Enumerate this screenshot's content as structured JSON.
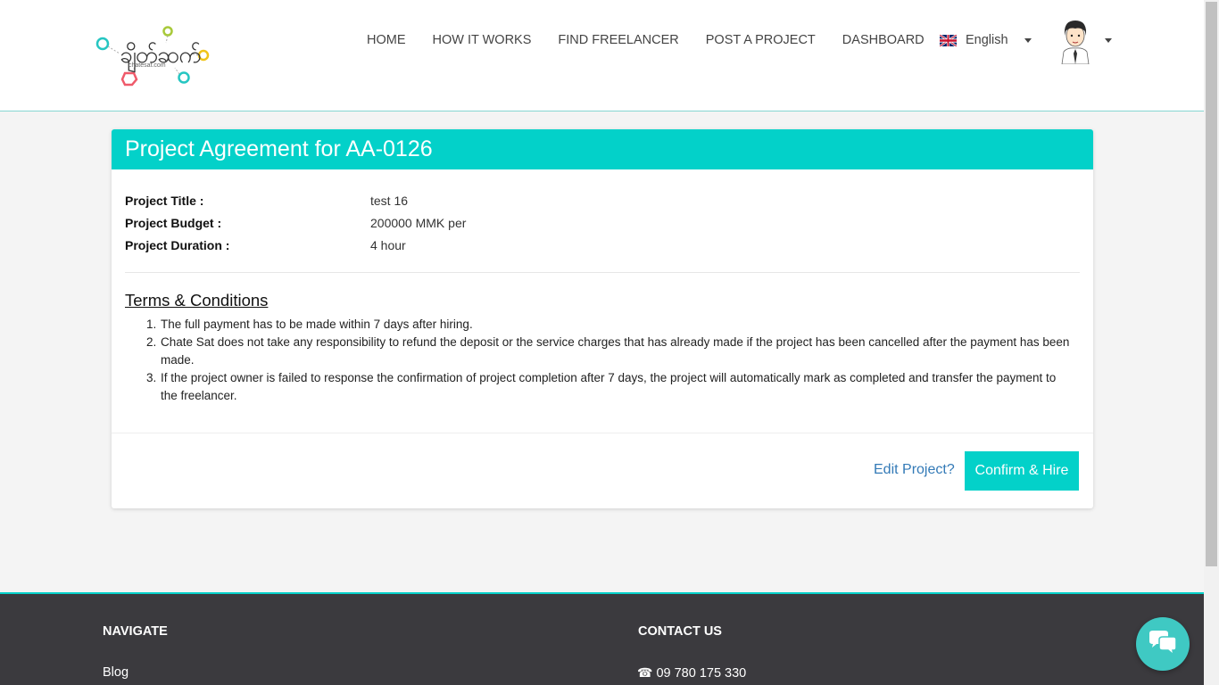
{
  "header": {
    "logo": {
      "text": "ချိတ်ဆက်",
      "subtext": "chatesat.com"
    },
    "nav": [
      "HOME",
      "HOW IT WORKS",
      "FIND FREELANCER",
      "POST A PROJECT",
      "DASHBOARD"
    ],
    "language": {
      "label": "English",
      "flag_icon": "uk-flag-icon"
    },
    "avatar_icon": "user-avatar-icon"
  },
  "card": {
    "title": "Project Agreement for AA-0126",
    "details": [
      {
        "label": "Project Title :",
        "value": "test 16"
      },
      {
        "label": "Project Budget :",
        "value": "200000 MMK per"
      },
      {
        "label": "Project Duration :",
        "value": "4 hour"
      }
    ],
    "terms_heading": "Terms & Conditions",
    "terms": [
      {
        "num": "1.",
        "text": "The full payment has to be made within 7 days after hiring."
      },
      {
        "num": "2.",
        "text": "Chate Sat does not take any responsibility to refund the deposit or the service charges that has already made if the project has been cancelled after the payment has been made."
      },
      {
        "num": "3.",
        "text": "If the project owner is failed to response the confirmation of project completion after 7 days, the project will automatically mark as completed and transfer the payment to the freelancer."
      }
    ],
    "edit_link": "Edit Project?",
    "confirm_button": "Confirm & Hire"
  },
  "footer": {
    "navigate_heading": "NAVIGATE",
    "navigate_items": [
      "Blog"
    ],
    "contact_heading": "CONTACT US",
    "phone": "09 780 175 330"
  },
  "colors": {
    "accent": "#03d1c9",
    "footer_bg": "#3b3a3e",
    "link": "#337ab7"
  }
}
